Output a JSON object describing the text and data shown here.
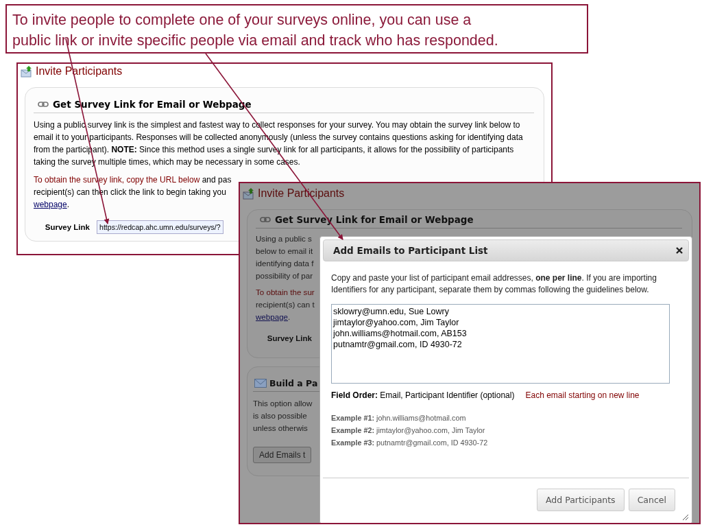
{
  "callout": {
    "lines": [
      "To invite people to complete one of your surveys online, you can use a",
      "public link or invite specific people via email and track who has responded."
    ]
  },
  "back_screen": {
    "title": "Invite Participants",
    "heading": "Get Survey Link for Email or Webpage",
    "paragraph": "Using a public survey link is the simplest and fastest way to collect responses for your survey. You may obtain the survey link below to email it to your participants. Responses will be collected anonymously (unless the survey contains questions asking for identifying data from the participant). **NOTE:** Since this method uses a single survey link for all participants, it allows for the possibility of participants taking the survey multiple times, which may be necessary in some cases.",
    "instruction_red": "To obtain the survey link, copy the URL below",
    "instruction_rest": " and pas",
    "instruction_line_2": "recipient(s) can then click the link to begin taking you",
    "link": "webpage",
    "link_after": ".",
    "survey_link": {
      "label": "Survey Link",
      "value": "https://redcap.ahc.umn.edu/surveys/?"
    }
  },
  "front_screen": {
    "title": "Invite Participants",
    "heading": "Get Survey Link for Email or Webpage",
    "lines": [
      "Using a public s",
      "below to email it",
      "identifying data f",
      "possibility of par"
    ],
    "red_line": "To obtain the sur",
    "line": "recipient(s) can t",
    "link": "webpage",
    "link_after": ".",
    "survey_link_label": "Survey Link",
    "section_2": {
      "heading": "Build a Pa",
      "lines": [
        "This option allow",
        "is also possible",
        "unless otherwis"
      ],
      "button": "Add Emails t"
    }
  },
  "dialog": {
    "title": "Add Emails to Participant List",
    "intro": "Copy and paste your list of participant email addresses, **one per line**. If you are importing Identifiers for any participant, separate them by commas following the guidelines below.",
    "textarea_lines": [
      "sklowry@umn.edu, Sue Lowry",
      "jimtaylor@yahoo.com, Jim Taylor",
      "john.williams@hotmail.com, AB153",
      "putnamtr@gmail.com, ID 4930-72"
    ],
    "field_order": {
      "label": "Field Order:",
      "value": "Email, Participant Identifier (optional)",
      "note": "Each email starting on new line"
    },
    "examples": [
      {
        "label": "Example #1:",
        "value": "john.williams@hotmail.com"
      },
      {
        "label": "Example #2:",
        "value": "jimtaylor@yahoo.com, Jim Taylor"
      },
      {
        "label": "Example #3:",
        "value": "putnamtr@gmail.com, ID 4930-72"
      }
    ],
    "buttons": [
      {
        "label": "Add Participants"
      },
      {
        "label": "Cancel"
      }
    ]
  }
}
